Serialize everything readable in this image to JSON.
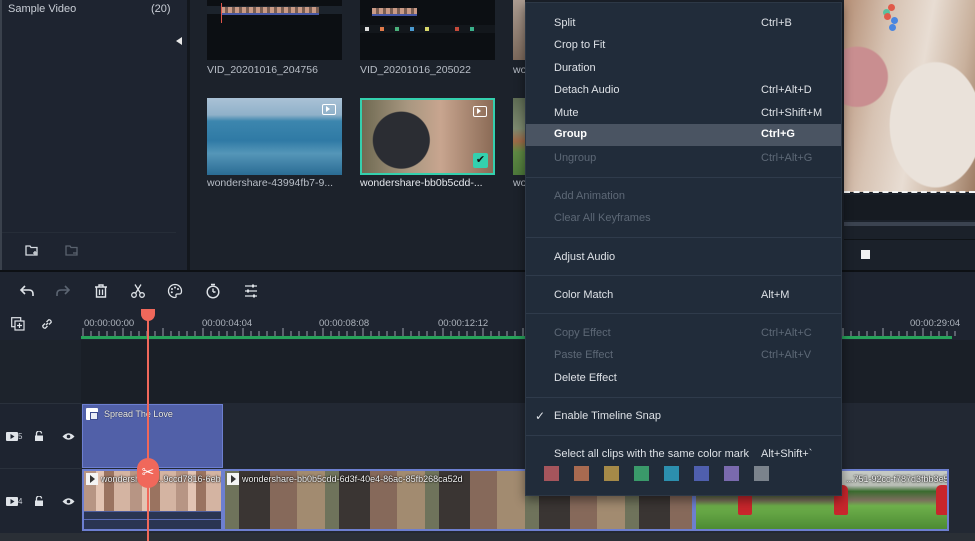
{
  "library": {
    "folder_title": "Sample Video",
    "folder_count": "(20)"
  },
  "media": {
    "items": [
      {
        "label": "VID_20201016_204756",
        "selected": false
      },
      {
        "label": "VID_20201016_205022",
        "selected": false
      },
      {
        "label": "wondershare-43994fb7-9...",
        "selected": false
      },
      {
        "label": "wondershare-bb0b5cdd-...",
        "selected": true
      },
      {
        "label": "wo",
        "selected": false
      },
      {
        "label": "wo",
        "selected": false
      }
    ]
  },
  "toolbar": {
    "icons": [
      "undo-icon",
      "redo-icon",
      "delete-icon",
      "cut-icon",
      "color-palette-icon",
      "speed-timer-icon",
      "adjust-icon"
    ]
  },
  "timeline": {
    "ruler_labels": [
      "00:00:00:00",
      "00:00:04:04",
      "00:00:08:08",
      "00:00:12:12",
      "00:00:29:04"
    ],
    "tracks": [
      {
        "number": "5",
        "clips": [
          {
            "label": "Spread The Love",
            "type": "title"
          }
        ]
      },
      {
        "number": "4",
        "clips": [
          {
            "label": "wondershare-...9ccd7816-6eb1",
            "type": "video"
          },
          {
            "label": "wondershare-bb0b5cdd-6d3f-40e4-86ac-85fb268ca52d",
            "type": "video"
          },
          {
            "label": "...751-92cc-f787d3fbb3e5",
            "type": "video"
          }
        ]
      }
    ]
  },
  "context_menu": {
    "items": [
      {
        "label": "Split",
        "shortcut": "Ctrl+B",
        "enabled": true
      },
      {
        "label": "Crop to Fit",
        "shortcut": "",
        "enabled": true
      },
      {
        "label": "Duration",
        "shortcut": "",
        "enabled": true
      },
      {
        "label": "Detach Audio",
        "shortcut": "Ctrl+Alt+D",
        "enabled": true
      },
      {
        "label": "Mute",
        "shortcut": "Ctrl+Shift+M",
        "enabled": true
      },
      {
        "label": "Group",
        "shortcut": "Ctrl+G",
        "enabled": true,
        "highlighted": true
      },
      {
        "label": "Ungroup",
        "shortcut": "Ctrl+Alt+G",
        "enabled": false
      },
      {
        "label": "Add Animation",
        "shortcut": "",
        "enabled": false
      },
      {
        "label": "Clear All Keyframes",
        "shortcut": "",
        "enabled": false
      },
      {
        "label": "Adjust Audio",
        "shortcut": "",
        "enabled": true
      },
      {
        "label": "Color Match",
        "shortcut": "Alt+M",
        "enabled": true
      },
      {
        "label": "Copy Effect",
        "shortcut": "Ctrl+Alt+C",
        "enabled": false
      },
      {
        "label": "Paste Effect",
        "shortcut": "Ctrl+Alt+V",
        "enabled": false
      },
      {
        "label": "Delete Effect",
        "shortcut": "",
        "enabled": true
      },
      {
        "label": "Enable Timeline Snap",
        "shortcut": "",
        "enabled": true,
        "checked": true
      },
      {
        "label": "Select all clips with the same color mark",
        "shortcut": "Alt+Shift+`",
        "enabled": true
      }
    ],
    "check_glyph": "✓",
    "color_marks": [
      "#a5555c",
      "#a86a50",
      "#a58a48",
      "#3a9a6a",
      "#2c8fae",
      "#4f5fae",
      "#7a6aae",
      "#7b838c"
    ]
  },
  "playhead": {
    "scissor_glyph": "✂"
  }
}
